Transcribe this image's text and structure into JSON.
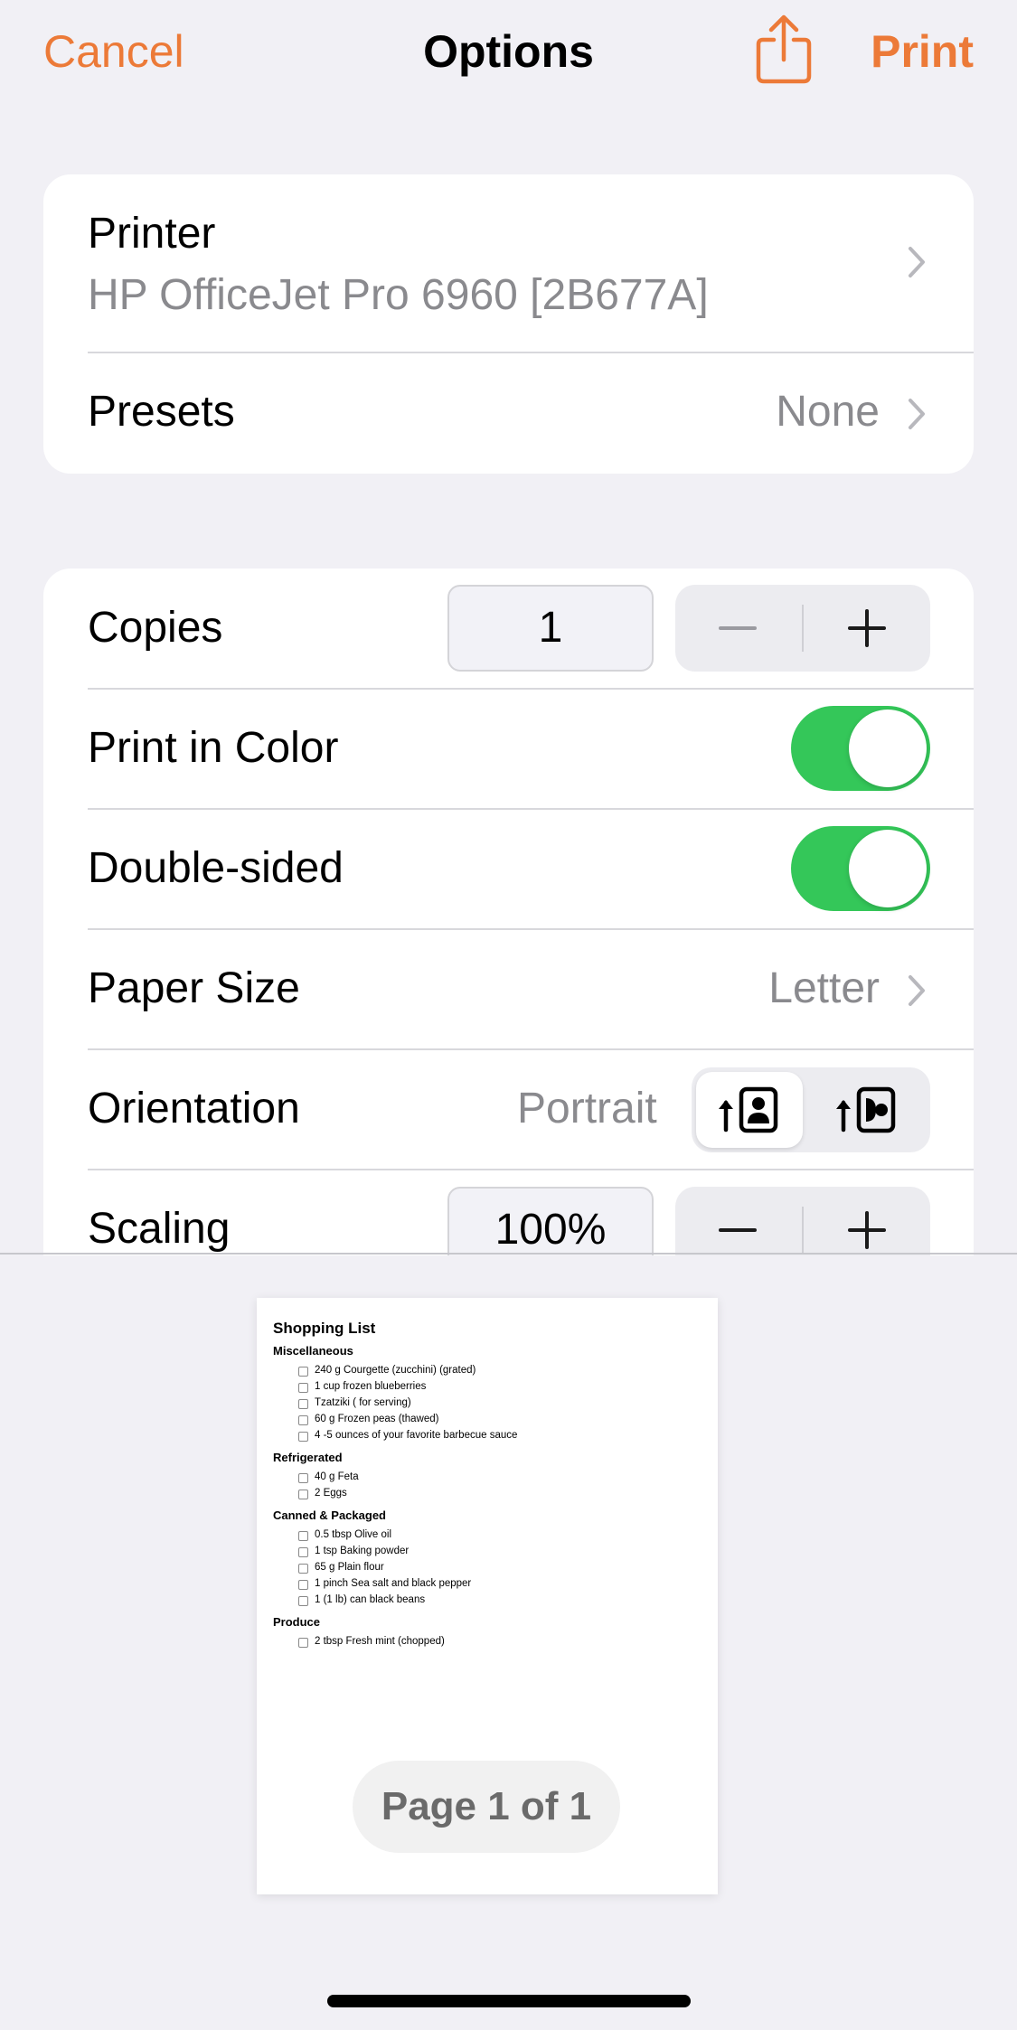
{
  "nav": {
    "cancel": "Cancel",
    "title": "Options",
    "share_icon": "share-icon",
    "print": "Print",
    "accent": "#ec7a38"
  },
  "printer_section": {
    "printer_label": "Printer",
    "printer_value": "HP OfficeJet Pro 6960 [2B677A]",
    "presets_label": "Presets",
    "presets_value": "None"
  },
  "options": {
    "copies_label": "Copies",
    "copies_value": "1",
    "print_color_label": "Print in Color",
    "print_color_on": true,
    "double_sided_label": "Double-sided",
    "double_sided_on": true,
    "toggle_color": "#34c759",
    "paper_size_label": "Paper Size",
    "paper_size_value": "Letter",
    "orientation_label": "Orientation",
    "orientation_value": "Portrait",
    "orientation_options": [
      "portrait-icon",
      "landscape-icon"
    ],
    "scaling_label": "Scaling",
    "scaling_value": "100%"
  },
  "preview": {
    "title": "Shopping List",
    "sections": [
      {
        "name": "Miscellaneous",
        "items": [
          "240 g Courgette (zucchini) (grated)",
          "1 cup frozen blueberries",
          "Tzatziki ( for serving)",
          "60 g Frozen peas (thawed)",
          "4 -5 ounces of your favorite barbecue sauce"
        ]
      },
      {
        "name": "Refrigerated",
        "items": [
          "40 g Feta",
          "2 Eggs"
        ]
      },
      {
        "name": "Canned & Packaged",
        "items": [
          "0.5 tbsp Olive oil",
          "1 tsp Baking powder",
          "65 g Plain flour",
          "1 pinch Sea salt and black pepper",
          "1 (1 lb) can black beans"
        ]
      },
      {
        "name": "Produce",
        "items": [
          "2 tbsp Fresh mint (chopped)"
        ]
      }
    ],
    "page_indicator": "Page 1 of 1"
  }
}
